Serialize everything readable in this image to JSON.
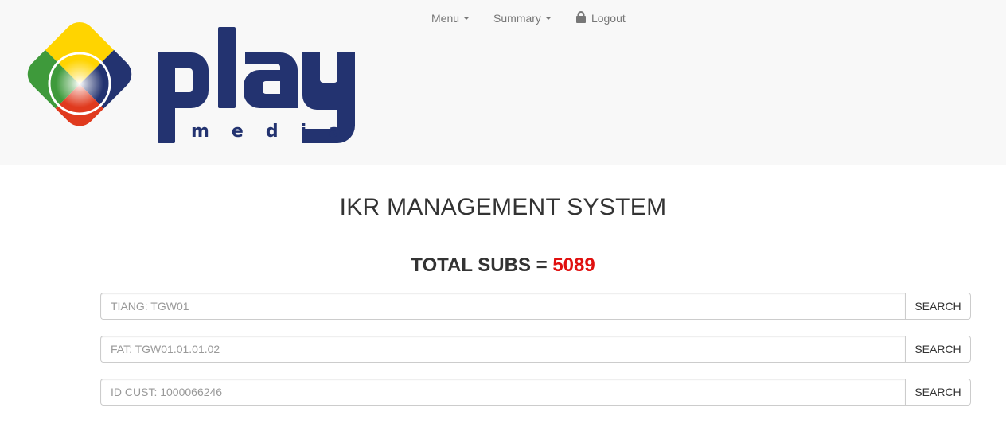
{
  "nav": {
    "menu_label": "Menu",
    "summary_label": "Summary",
    "logout_label": "Logout"
  },
  "logo": {
    "word": "play",
    "sub": "media",
    "colors": {
      "navy": "#233370",
      "yellow": "#ffd400",
      "green": "#3e9a3b",
      "red": "#e03a1e"
    }
  },
  "page": {
    "title": "IKR MANAGEMENT SYSTEM",
    "total_label": "TOTAL SUBS = ",
    "total_value": "5089"
  },
  "search": [
    {
      "placeholder": "TIANG: TGW01",
      "button": "SEARCH"
    },
    {
      "placeholder": "FAT: TGW01.01.01.02",
      "button": "SEARCH"
    },
    {
      "placeholder": "ID CUST: 1000066246",
      "button": "SEARCH"
    }
  ],
  "colors": {
    "accent_red": "#e0100f",
    "navbar_bg": "#f8f8f8"
  }
}
